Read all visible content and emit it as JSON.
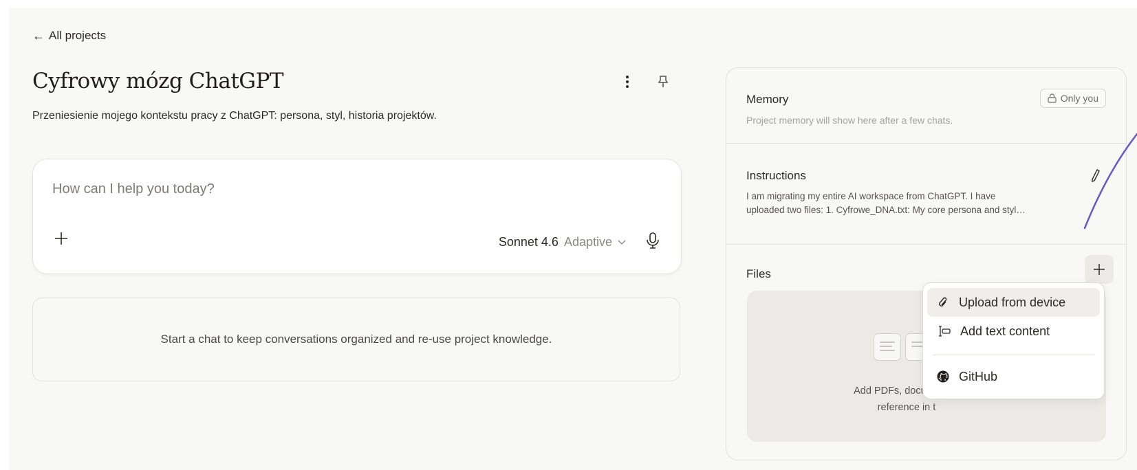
{
  "nav": {
    "back_label": "All projects"
  },
  "project": {
    "title": "Cyfrowy mózg ChatGPT",
    "description": "Przeniesienie mojego kontekstu pracy z ChatGPT: persona, styl, historia projektów."
  },
  "composer": {
    "placeholder": "How can I help you today?",
    "model_name": "Sonnet 4.6",
    "model_mode": "Adaptive"
  },
  "chats": {
    "empty_text": "Start a chat to keep conversations organized and re-use project knowledge."
  },
  "memory": {
    "title": "Memory",
    "visibility": "Only you",
    "hint": "Project memory will show here after a few chats."
  },
  "instructions": {
    "title": "Instructions",
    "line1": "I am migrating my entire AI workspace from ChatGPT. I have",
    "line2": "uploaded two files: 1. Cyfrowe_DNA.txt: My core persona and styl…"
  },
  "files": {
    "title": "Files",
    "drop_line1": "Add PDFs, documen",
    "drop_line2": "reference in t"
  },
  "menu": {
    "items": [
      {
        "label": "Upload from device",
        "icon": "paperclip-icon"
      },
      {
        "label": "Add text content",
        "icon": "text-input-icon"
      },
      {
        "label": "GitHub",
        "icon": "github-icon"
      }
    ]
  },
  "colors": {
    "annotation_line": "#6b56c9",
    "accent_bg": "#ebeae6"
  }
}
